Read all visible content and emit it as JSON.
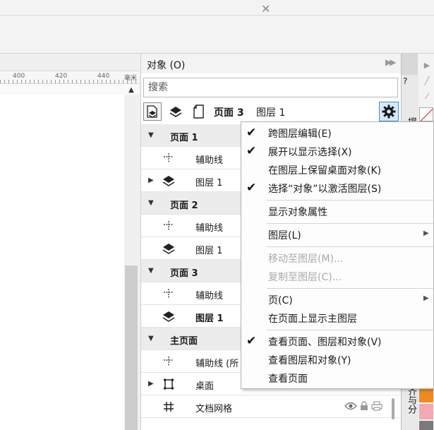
{
  "ruler": {
    "ticks": [
      "400",
      "420",
      "440"
    ],
    "unit": "毫米"
  },
  "panel": {
    "title": "对象 (O)",
    "search_placeholder": "搜索",
    "current_page": "页面 3",
    "current_layer": "图层 1",
    "tree": [
      {
        "kind": "page",
        "label": "页面 1"
      },
      {
        "kind": "child",
        "icon": "guides-icon",
        "label": "辅助线"
      },
      {
        "kind": "child",
        "icon": "layer-icon",
        "label": "图层 1",
        "expandable": true
      },
      {
        "kind": "page",
        "label": "页面 2"
      },
      {
        "kind": "child",
        "icon": "guides-icon",
        "label": "辅助线"
      },
      {
        "kind": "child",
        "icon": "layer-icon",
        "label": "图层 1"
      },
      {
        "kind": "page",
        "label": "页面 3"
      },
      {
        "kind": "child",
        "icon": "guides-icon",
        "label": "辅助线"
      },
      {
        "kind": "child",
        "icon": "layer-icon",
        "label": "图层 1",
        "bold": true
      },
      {
        "kind": "page",
        "label": "主页面"
      },
      {
        "kind": "child",
        "icon": "guides-icon",
        "label": "辅助线 (所"
      },
      {
        "kind": "child",
        "icon": "desktop-icon",
        "label": "桌面",
        "expandable": true
      },
      {
        "kind": "child",
        "icon": "grid-icon",
        "label": "文档网格"
      }
    ]
  },
  "dock": {
    "hint_label": "提示(",
    "align_label": "对齐与分",
    "hint_icon": "?"
  },
  "context_menu": {
    "items": [
      {
        "label": "跨图层编辑(E)",
        "checked": true
      },
      {
        "label": "展开以显示选择(X)",
        "checked": true
      },
      {
        "label": "在图层上保留桌面对象(K)",
        "checked": false
      },
      {
        "label": "选择“对象”以激活图层(S)",
        "checked": true
      },
      {
        "separator": true
      },
      {
        "label": "显示对象属性",
        "checked": false
      },
      {
        "separator": true
      },
      {
        "label": "图层(L)",
        "submenu": true
      },
      {
        "separator": true
      },
      {
        "label": "移动至图层(M)...",
        "disabled": true
      },
      {
        "label": "复制至图层(C)...",
        "disabled": true
      },
      {
        "separator": true
      },
      {
        "label": "页(C)",
        "submenu": true
      },
      {
        "label": "在页面上显示主图层"
      },
      {
        "separator": true
      },
      {
        "label": "查看页面、图层和对象(V)",
        "checked": true
      },
      {
        "label": "查看图层和对象(Y)"
      },
      {
        "label": "查看页面"
      }
    ]
  },
  "colors": {
    "accent": "#3c8fd8",
    "swatch_orange": "#f08a1c",
    "swatch_pink": "#f4a8b4",
    "swatch_gray": "#7a7a7a"
  }
}
